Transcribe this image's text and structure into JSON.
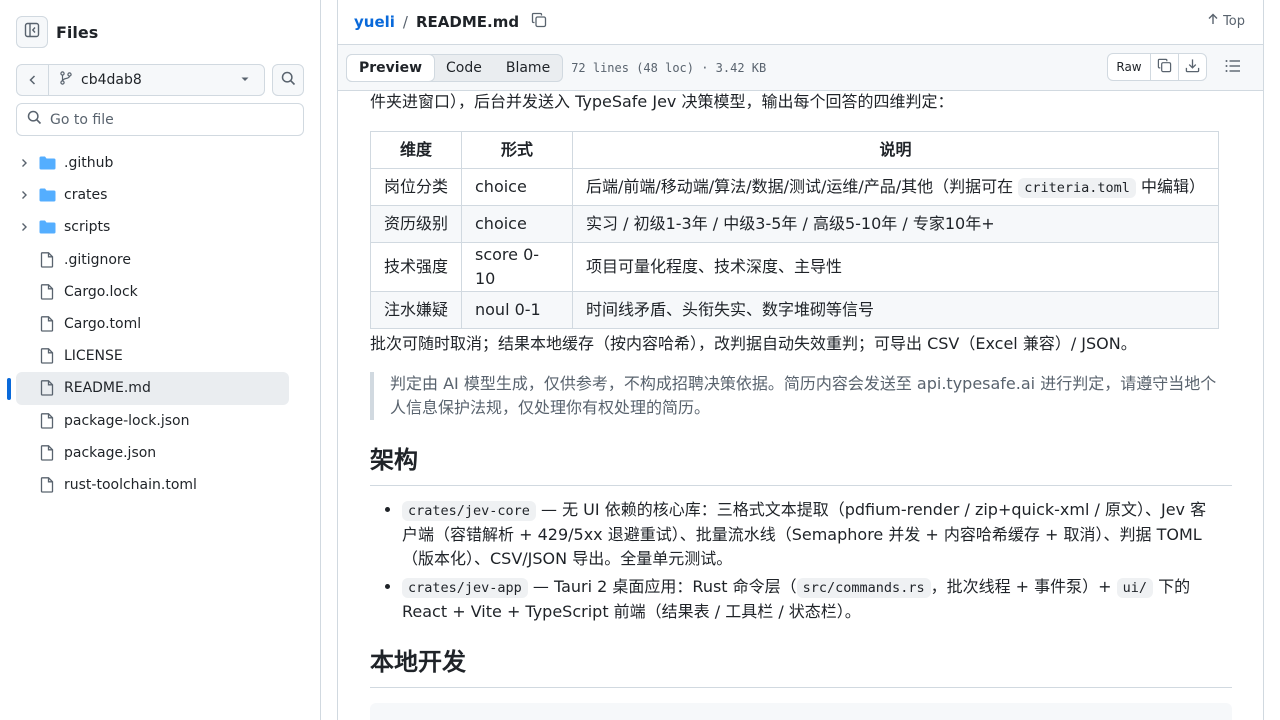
{
  "sidebar": {
    "title": "Files",
    "branch": "cb4dab8",
    "goto_placeholder": "Go to file",
    "items": [
      {
        "type": "folder",
        "label": ".github"
      },
      {
        "type": "folder",
        "label": "crates"
      },
      {
        "type": "folder",
        "label": "scripts"
      },
      {
        "type": "file",
        "label": ".gitignore"
      },
      {
        "type": "file",
        "label": "Cargo.lock"
      },
      {
        "type": "file",
        "label": "Cargo.toml"
      },
      {
        "type": "file",
        "label": "LICENSE"
      },
      {
        "type": "file",
        "label": "README.md",
        "active": true
      },
      {
        "type": "file",
        "label": "package-lock.json"
      },
      {
        "type": "file",
        "label": "package.json"
      },
      {
        "type": "file",
        "label": "rust-toolchain.toml"
      }
    ]
  },
  "header": {
    "repo": "yueli",
    "separator": "/",
    "file": "README.md",
    "top_label": "Top"
  },
  "filebar": {
    "tabs": [
      "Preview",
      "Code",
      "Blame"
    ],
    "info": "72 lines (48 loc) · 3.42 KB",
    "raw_label": "Raw"
  },
  "readme": {
    "intro": "件夹进窗口），后台并发送入 TypeSafe Jev 决策模型，输出每个回答的四维判定：",
    "table": {
      "headers": [
        "维度",
        "形式",
        "说明"
      ],
      "rows": [
        {
          "dim": "岗位分类",
          "form": "choice",
          "desc_pre": "后端/前端/移动端/算法/数据/测试/运维/产品/其他（判据可在 ",
          "desc_code": "criteria.toml",
          "desc_post": " 中编辑）"
        },
        {
          "dim": "资历级别",
          "form": "choice",
          "desc": "实习 / 初级1-3年 / 中级3-5年 / 高级5-10年 / 专家10年+"
        },
        {
          "dim": "技术强度",
          "form": "score 0-10",
          "desc": "项目可量化程度、技术深度、主导性"
        },
        {
          "dim": "注水嫌疑",
          "form": "noul 0-1",
          "desc": "时间线矛盾、头衔失实、数字堆砌等信号"
        }
      ]
    },
    "cancel_para": "批次可随时取消；结果本地缓存（按内容哈希），改判据自动失效重判；可导出 CSV（Excel 兼容）/ JSON。",
    "quote": "判定由 AI 模型生成，仅供参考，不构成招聘决策依据。简历内容会发送至 api.typesafe.ai 进行判定，请遵守当地个人信息保护法规，仅处理你有权处理的简历。",
    "h_arch": "架构",
    "arch_items": [
      {
        "code": "crates/jev-core",
        "text": " — 无 UI 依赖的核心库：三格式文本提取（pdfium-render / zip+quick-xml / 原文）、Jev 客户端（容错解析 + 429/5xx 退避重试）、批量流水线（Semaphore 并发 + 内容哈希缓存 + 取消）、判据 TOML（版本化）、CSV/JSON 导出。全量单元测试。"
      },
      {
        "code": "crates/jev-app",
        "text_a": " — Tauri 2 桌面应用：Rust 命令层（",
        "code2": "src/commands.rs",
        "text_b": "，批次线程 + 事件泵）+ ",
        "code3": "ui/",
        "text_c": " 下的 React + Vite + TypeScript 前端（结果表 / 工具栏 / 状态栏）。"
      }
    ],
    "h_dev": "本地开发"
  }
}
